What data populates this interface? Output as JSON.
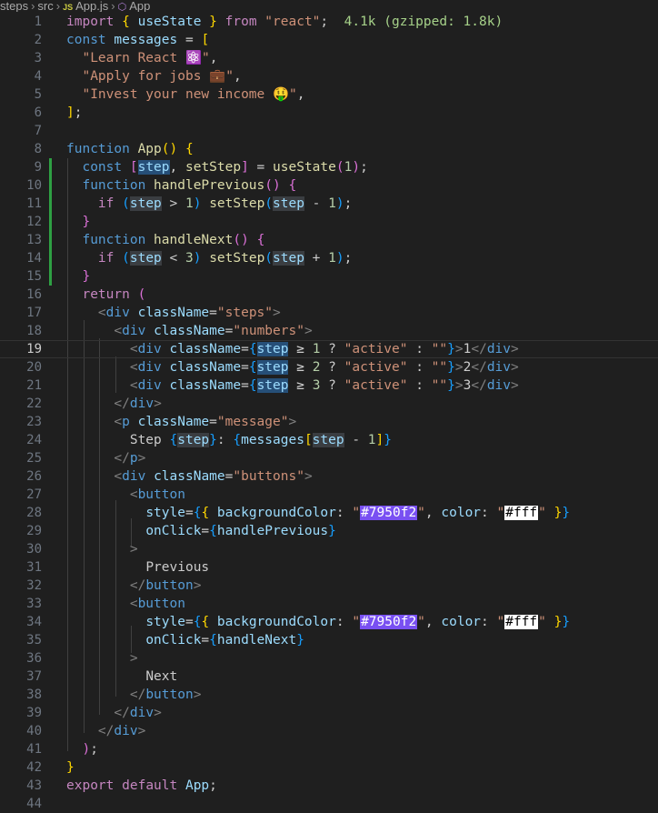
{
  "breadcrumb": {
    "items": [
      "steps",
      "src",
      "App.js",
      "App"
    ],
    "file_icon_text": "JS"
  },
  "editor": {
    "current_line": 19,
    "import_size": "4.1k (gzipped: 1.8k)",
    "lines": [
      {
        "n": "1"
      },
      {
        "n": "2"
      },
      {
        "n": "3"
      },
      {
        "n": "4"
      },
      {
        "n": "5"
      },
      {
        "n": "6"
      },
      {
        "n": "7"
      },
      {
        "n": "8"
      },
      {
        "n": "9"
      },
      {
        "n": "10"
      },
      {
        "n": "11"
      },
      {
        "n": "12"
      },
      {
        "n": "13"
      },
      {
        "n": "14"
      },
      {
        "n": "15"
      },
      {
        "n": "16"
      },
      {
        "n": "17"
      },
      {
        "n": "18"
      },
      {
        "n": "19"
      },
      {
        "n": "20"
      },
      {
        "n": "21"
      },
      {
        "n": "22"
      },
      {
        "n": "23"
      },
      {
        "n": "24"
      },
      {
        "n": "25"
      },
      {
        "n": "26"
      },
      {
        "n": "27"
      },
      {
        "n": "28"
      },
      {
        "n": "29"
      },
      {
        "n": "30"
      },
      {
        "n": "31"
      },
      {
        "n": "32"
      },
      {
        "n": "33"
      },
      {
        "n": "34"
      },
      {
        "n": "35"
      },
      {
        "n": "36"
      },
      {
        "n": "37"
      },
      {
        "n": "38"
      },
      {
        "n": "39"
      },
      {
        "n": "40"
      },
      {
        "n": "41"
      },
      {
        "n": "42"
      },
      {
        "n": "43"
      },
      {
        "n": "44"
      }
    ]
  },
  "code": {
    "messages": [
      "Learn React ⚛️",
      "Apply for jobs 💼",
      "Invest your new income 🤑"
    ],
    "swatch_primary": "#7950f2",
    "swatch_secondary": "#fff",
    "button_labels": [
      "Previous",
      "Next"
    ]
  },
  "colors": {
    "background": "#1f1f1f",
    "keyword": "#569cd6",
    "control": "#c586c0",
    "function": "#dcdcaa",
    "string": "#ce9178",
    "selection": "#264f78",
    "modified": "#2ea043",
    "accent_swatch": "#7950f2"
  }
}
